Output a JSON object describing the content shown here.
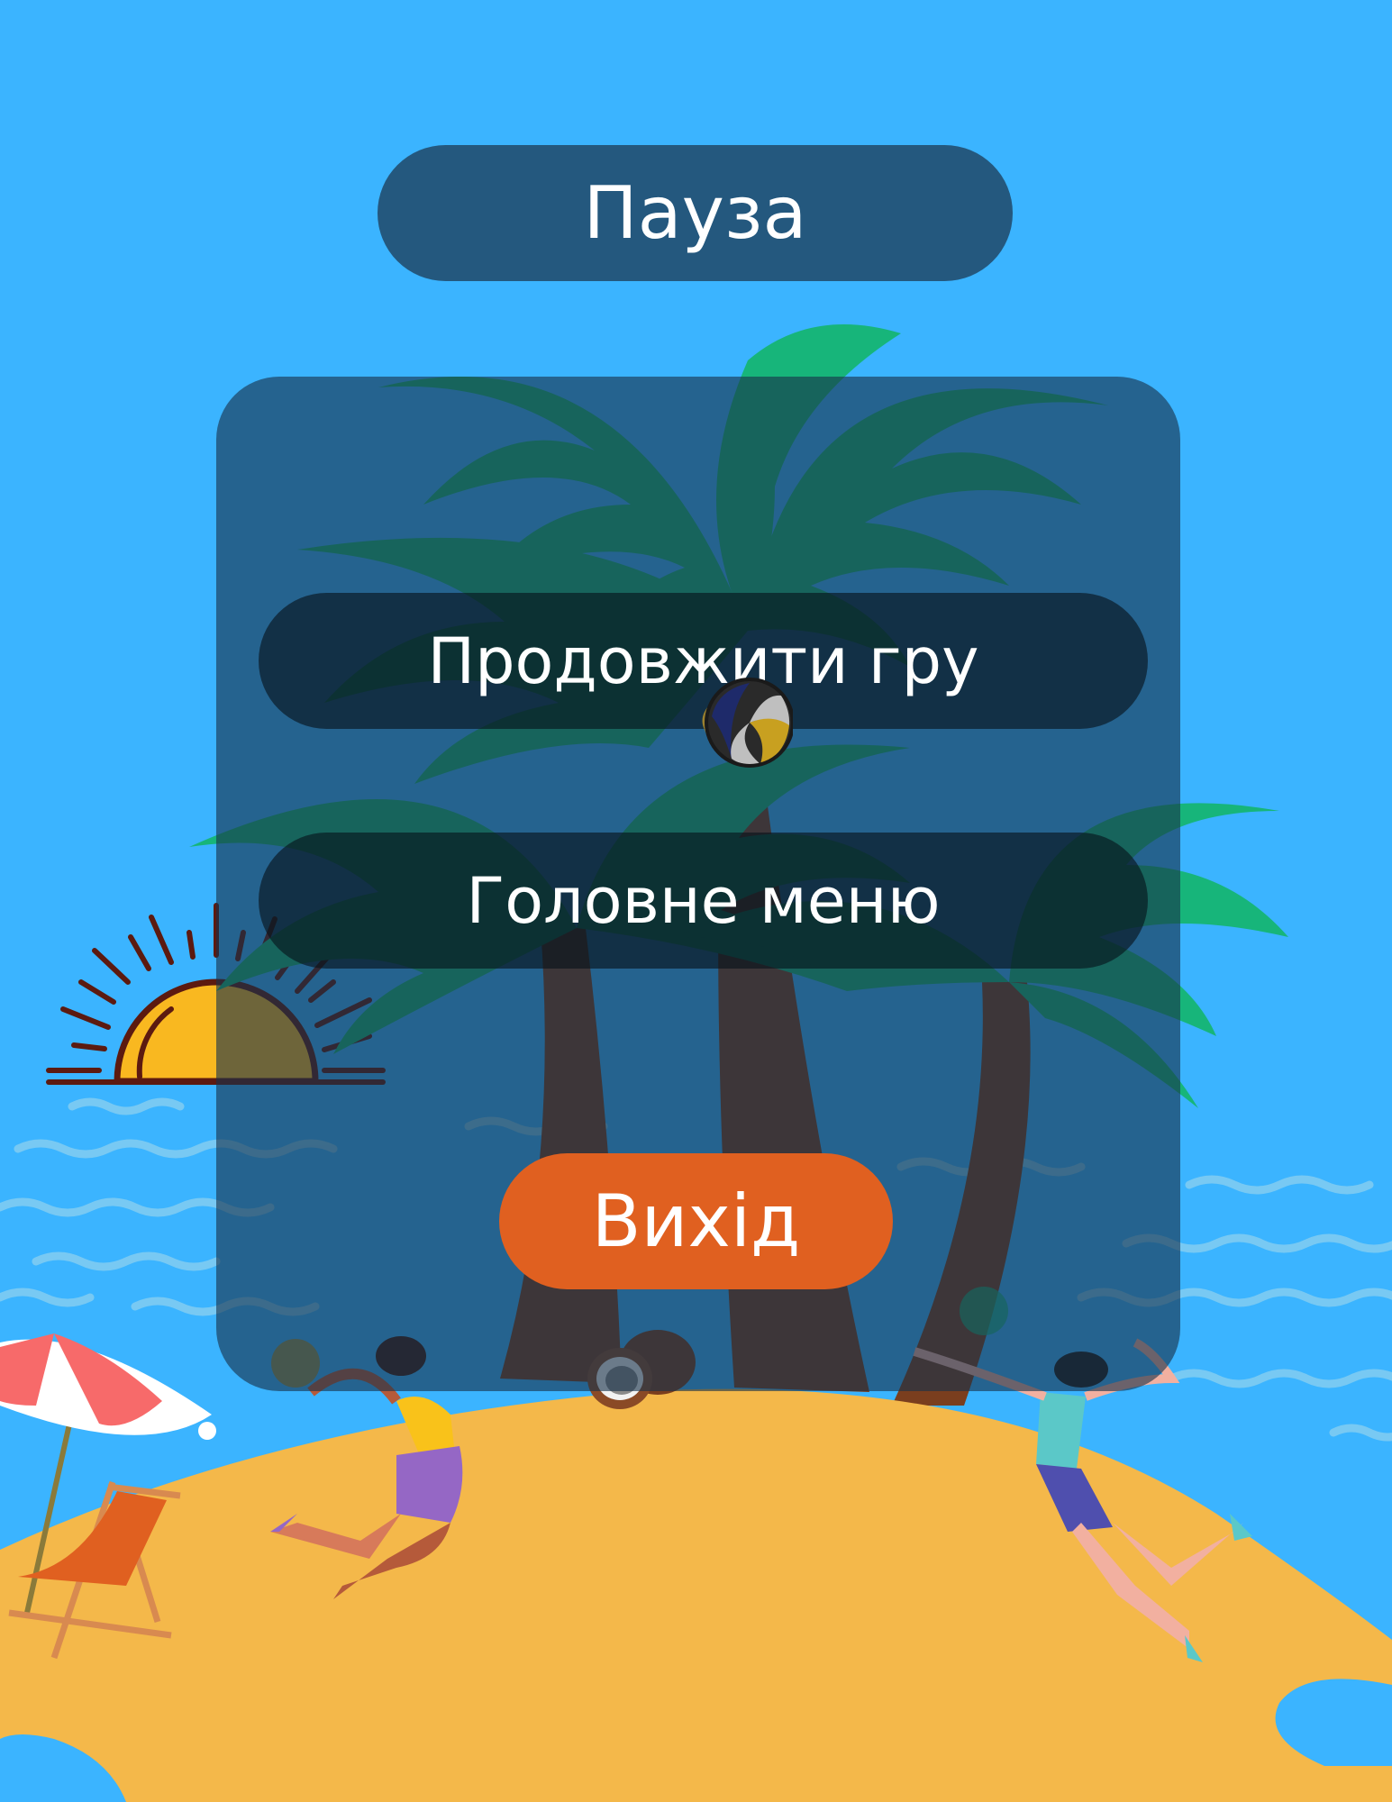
{
  "pause_menu": {
    "title": "Пауза",
    "continue_label": "Продовжити гру",
    "main_menu_label": "Головне меню",
    "exit_label": "Вихід"
  },
  "colors": {
    "sky": "#3BB4FF",
    "sand": "#F4B84A",
    "exit_button": "#E06020",
    "panel_overlay": "#1E3E5A",
    "button_overlay": "#06121A",
    "palm_leaf": "#17B57A",
    "palm_trunk": "#7A3E1E",
    "sun": "#F9B820"
  },
  "scene_items": [
    "palm-tree",
    "sun",
    "sea-waves",
    "island",
    "beach-umbrella",
    "deck-chair",
    "volleyball",
    "coconut",
    "player-left",
    "player-right"
  ]
}
